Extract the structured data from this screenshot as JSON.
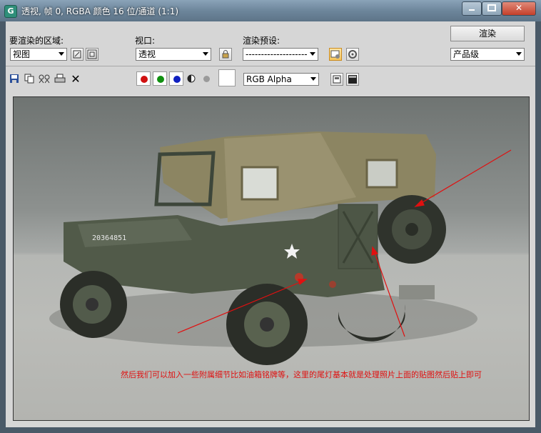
{
  "window": {
    "title": "透视, 帧 0, RGBA 颜色 16 位/通道 (1:1)",
    "app_icon_letter": "G",
    "controls": [
      "minimize-icon",
      "maximize-icon",
      "close-icon"
    ]
  },
  "toolbar": {
    "region_label": "要渲染的区域:",
    "region_value": "视图",
    "viewport_label": "视口:",
    "viewport_value": "透视",
    "preset_label": "渲染预设:",
    "preset_value": "--------------------",
    "render_button": "渲染",
    "quality_value": "产品级",
    "channel_value": "RGB Alpha"
  },
  "colors": {
    "red_channel": "#d01010",
    "green_channel": "#109010",
    "blue_channel": "#1020c0",
    "annotation": "#e01010"
  },
  "render": {
    "plate_text": "20364851",
    "annotation": "然后我们可以加入一些附属细节比如油箱铭牌等，这里的尾灯基本就是处理照片上面的贴图然后贴上即可"
  }
}
